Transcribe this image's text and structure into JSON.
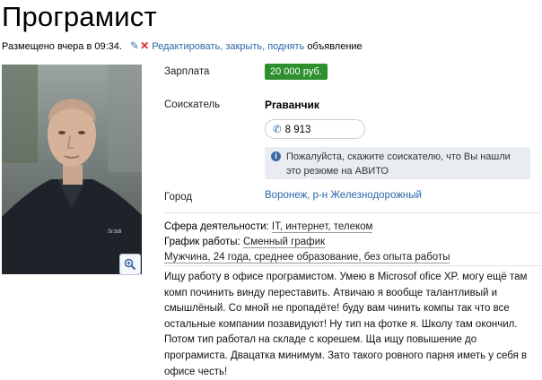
{
  "title": "Програмист",
  "meta": {
    "posted": "Размещено вчера в 09:34.",
    "actions_link": "Редактировать, закрыть, поднять",
    "suffix": "объявление"
  },
  "fields": {
    "salary_label": "Зарплата",
    "salary_value": "20 000 руб.",
    "seeker_label": "Соискатель",
    "seeker_name": "Praванчик",
    "phone": "8 913",
    "notice": "Пожалуйста, скажите соискателю, что Вы нашли это резюме на АВИТО",
    "city_label": "Город",
    "city_value": "Воронеж, р-н Железнодорожный"
  },
  "facts": {
    "sphere_label": "Сфера деятельности:",
    "sphere_value": "IT, интернет, телеком",
    "schedule_label": "График работы:",
    "schedule_value": "Сменный график",
    "bio": "Мужчина, 24 года, среднее образование, без опыта работы"
  },
  "description": "Ищу работу в офисе програмистом. Умею в Microsof ofice XP. могу ещё там комп починить винду переставить. Атвичаю я вообще талантливый и смышлёный. Со мной не пропадёте! буду вам чинить компы так что все остальные компании позавидуют! Ну тип на фотке я. Школу там окончил. Потом тип работал на складе с корешем. Ща ищу повышение до програмиста. Двацатка минимум. Зато такого ровного парня иметь у себя в офисе честь!",
  "colors": {
    "link": "#2b67a8",
    "salary_bg": "#2d8f2d",
    "notice_bg": "#e9edf2"
  }
}
